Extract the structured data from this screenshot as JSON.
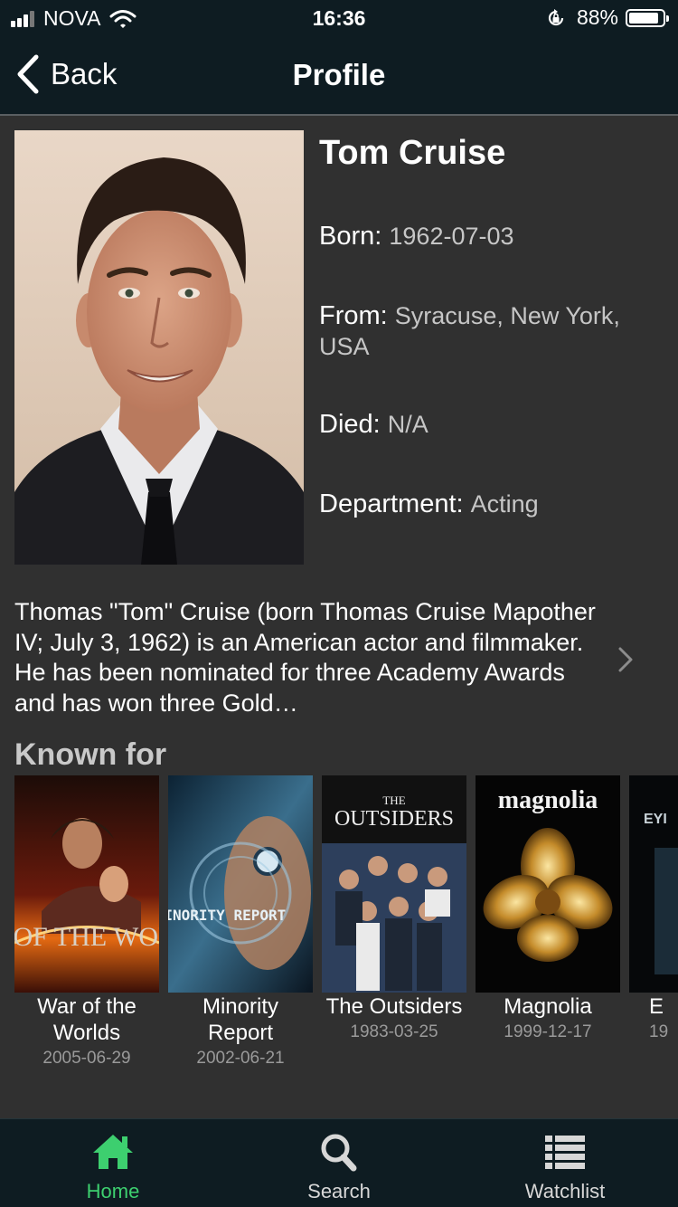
{
  "status_bar": {
    "carrier": "NOVA",
    "time": "16:36",
    "battery_percent": "88%",
    "battery_level": 0.88,
    "signal_bars": 3,
    "signal_total": 4
  },
  "nav": {
    "back_label": "Back",
    "title": "Profile"
  },
  "profile": {
    "name": "Tom Cruise",
    "born_label": "Born:",
    "born_value": "1962-07-03",
    "from_label": "From:",
    "from_value": "Syracuse, New York, USA",
    "died_label": "Died:",
    "died_value": "N/A",
    "department_label": "Department:",
    "department_value": "Acting",
    "bio": "Thomas \"Tom\" Cruise (born Thomas Cruise Mapother IV; July 3, 1962) is an American actor and filmmaker. He has been nominated for three Academy Awards and has won three Gold…"
  },
  "known_for": {
    "heading": "Known for",
    "movies": [
      {
        "title": "War of the Worlds",
        "date": "2005-06-29",
        "poster_text": "WAR OF THE WORLDS"
      },
      {
        "title": "Minority Report",
        "date": "2002-06-21",
        "poster_text": "MINORITY REPORT"
      },
      {
        "title": "The Outsiders",
        "date": "1983-03-25",
        "poster_text_top": "THE",
        "poster_text": "OUTSIDERS"
      },
      {
        "title": "Magnolia",
        "date": "1999-12-17",
        "poster_text": "magnolia"
      },
      {
        "title": "E",
        "date": "19",
        "poster_text": "EYI"
      }
    ]
  },
  "tabbar": {
    "tabs": [
      {
        "label": "Home",
        "icon": "home-icon",
        "active": true
      },
      {
        "label": "Search",
        "icon": "search-icon",
        "active": false
      },
      {
        "label": "Watchlist",
        "icon": "list-icon",
        "active": false
      }
    ]
  },
  "colors": {
    "bar_background": "#0e1c22",
    "page_background": "#303030",
    "accent_active": "#3dcf6f",
    "secondary_text": "#c6c6c6",
    "date_text": "#9a9a9a"
  }
}
